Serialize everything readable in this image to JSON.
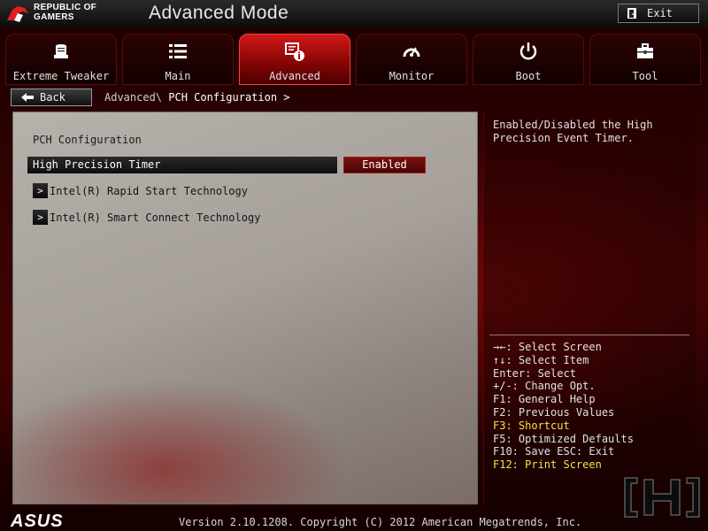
{
  "header": {
    "brand_line1": "REPUBLIC OF",
    "brand_line2": "GAMERS",
    "mode_title": "Advanced Mode",
    "exit_label": "Exit",
    "exit_icon": "exit-door-icon"
  },
  "tabs": [
    {
      "label": "Extreme Tweaker",
      "icon": "cpu-cooler-icon",
      "active": false
    },
    {
      "label": "Main",
      "icon": "list-icon",
      "active": false
    },
    {
      "label": "Advanced",
      "icon": "advanced-info-icon",
      "active": true
    },
    {
      "label": "Monitor",
      "icon": "gauge-icon",
      "active": false
    },
    {
      "label": "Boot",
      "icon": "power-icon",
      "active": false
    },
    {
      "label": "Tool",
      "icon": "toolbox-icon",
      "active": false
    }
  ],
  "nav": {
    "back_label": "Back",
    "breadcrumb_parent": "Advanced\\",
    "breadcrumb_current": "PCH Configuration >"
  },
  "main": {
    "section_title": "PCH Configuration",
    "setting": {
      "label": "High Precision Timer",
      "value": "Enabled"
    },
    "submenus": [
      {
        "label": "Intel(R) Rapid Start Technology"
      },
      {
        "label": "Intel(R) Smart Connect Technology"
      }
    ]
  },
  "help": {
    "text": "Enabled/Disabled the High Precision Event Timer."
  },
  "shortcuts": [
    {
      "text": "→←: Select Screen",
      "highlight": false
    },
    {
      "text": "↑↓: Select Item",
      "highlight": false
    },
    {
      "text": "Enter: Select",
      "highlight": false
    },
    {
      "text": "+/-: Change Opt.",
      "highlight": false
    },
    {
      "text": "F1: General Help",
      "highlight": false
    },
    {
      "text": "F2: Previous Values",
      "highlight": false
    },
    {
      "text": "F3: Shortcut",
      "highlight": true
    },
    {
      "text": "F5: Optimized Defaults",
      "highlight": false
    },
    {
      "text": "F10: Save  ESC: Exit",
      "highlight": false
    },
    {
      "text": "F12: Print Screen",
      "highlight": true
    }
  ],
  "footer": {
    "brand": "ASUS",
    "version": "Version 2.10.1208. Copyright (C) 2012 American Megatrends, Inc.",
    "watermark": "[H]"
  },
  "colors": {
    "accent": "#c01010",
    "shortcut_highlight": "#f2e24a",
    "panel": "#aaa39d"
  }
}
